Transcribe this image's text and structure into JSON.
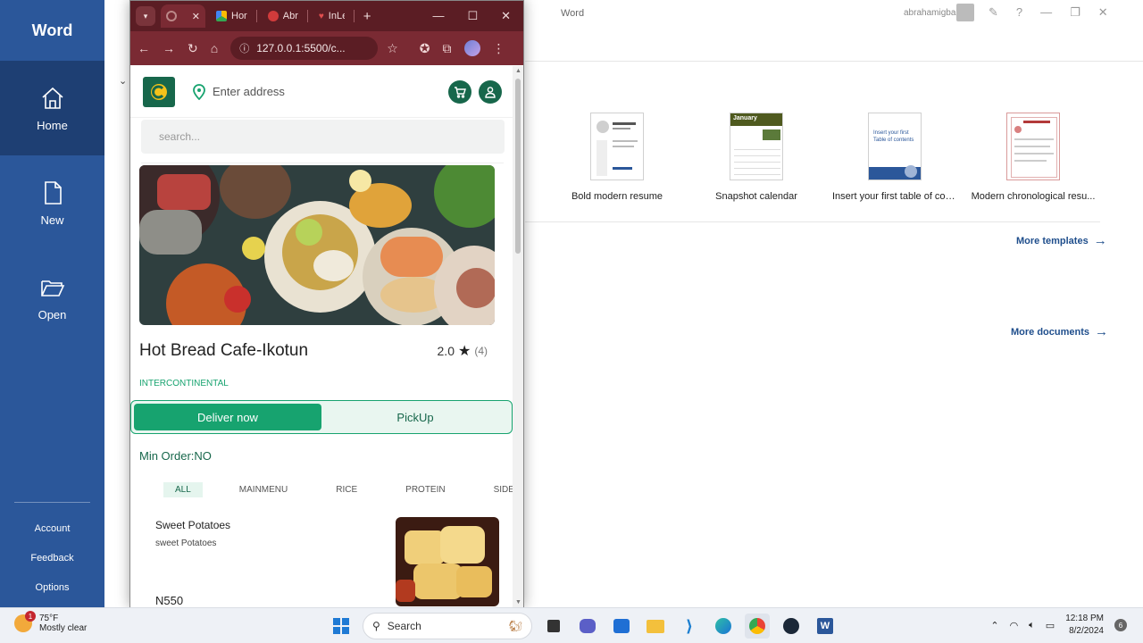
{
  "word": {
    "app_title": "Word",
    "window_title": "Word",
    "user_name": "abrahamigbal",
    "nav": [
      {
        "label": "Home"
      },
      {
        "label": "New"
      },
      {
        "label": "Open"
      }
    ],
    "bottom_nav": [
      {
        "label": "Account"
      },
      {
        "label": "Feedback"
      },
      {
        "label": "Options"
      }
    ],
    "templates": [
      {
        "label": "Bold modern resume"
      },
      {
        "label": "Snapshot calendar",
        "thumb_text": "January"
      },
      {
        "label": "Insert your first table of con...",
        "thumb_text": "Insert your first Table of contents"
      },
      {
        "label": "Modern chronological resu..."
      }
    ],
    "more_templates": "More templates",
    "more_documents": "More documents"
  },
  "browser": {
    "tabs": [
      {
        "title": "Hor"
      },
      {
        "title": "Abr"
      },
      {
        "title": "InLe"
      }
    ],
    "url": "127.0.0.1:5500/c...",
    "colors": {
      "frame": "#5b1d24",
      "toolbar": "#7a2a33"
    }
  },
  "site": {
    "address_placeholder": "Enter address",
    "search_placeholder": "search...",
    "restaurant": {
      "name": "Hot Bread Cafe-Ikotun",
      "rating": "2.0",
      "rating_count": "(4)",
      "category": "INTERCONTINENTAL"
    },
    "delivery_options": [
      "Deliver now",
      "PickUp"
    ],
    "selected_option": "Deliver now",
    "min_order": "Min Order:NO",
    "menu_tabs": [
      "ALL",
      "MAINMENU",
      "RICE",
      "PROTEIN",
      "SIDES"
    ],
    "active_menu_tab": "ALL",
    "items": [
      {
        "name": "Sweet Potatoes",
        "description": "sweet Potatoes",
        "price": "N550"
      }
    ],
    "colors": {
      "brand": "#17674b",
      "accent": "#17a36f"
    }
  },
  "taskbar": {
    "weather_temp": "75°F",
    "weather_desc": "Mostly clear",
    "weather_badge": "1",
    "search_label": "Search",
    "time": "12:18 PM",
    "date": "8/2/2024",
    "notifications": "6"
  }
}
